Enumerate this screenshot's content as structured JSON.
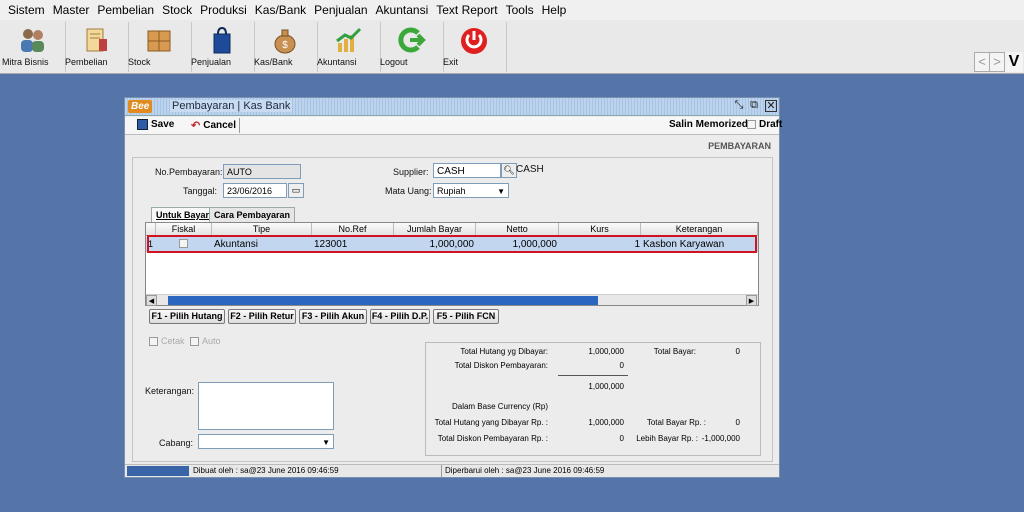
{
  "menu": [
    "Sistem",
    "Master",
    "Pembelian",
    "Stock",
    "Produksi",
    "Kas/Bank",
    "Penjualan",
    "Akuntansi",
    "Text Report",
    "Tools",
    "Help"
  ],
  "toolbar": [
    {
      "label": "Mitra Bisnis",
      "icon": "people-icon"
    },
    {
      "label": "Pembelian",
      "icon": "purchase-icon"
    },
    {
      "label": "Stock",
      "icon": "box-icon"
    },
    {
      "label": "Penjualan",
      "icon": "shopping-bag-icon"
    },
    {
      "label": "Kas/Bank",
      "icon": "money-bag-icon"
    },
    {
      "label": "Akuntansi",
      "icon": "chart-icon"
    },
    {
      "label": "Logout",
      "icon": "logout-icon"
    },
    {
      "label": "Exit",
      "icon": "power-icon"
    }
  ],
  "nav": {
    "prev": "<",
    "next": ">",
    "v": "V"
  },
  "window": {
    "logo": "Bee",
    "title": "Pembayaran | Kas Bank",
    "save": "Save",
    "cancel": "Cancel",
    "salin": "Salin Memorized",
    "draft": "Draft",
    "header": "PEMBAYARAN"
  },
  "form": {
    "no_label": "No.Pembayaran:",
    "no_value": "AUTO",
    "tanggal_label": "Tanggal:",
    "tanggal_value": "23/06/2016",
    "supplier_label": "Supplier:",
    "supplier_value": "CASH",
    "supplier_name": "CASH",
    "mata_uang_label": "Mata Uang:",
    "mata_uang_value": "Rupiah"
  },
  "tabs": [
    "Untuk Bayar",
    "Cara Pembayaran"
  ],
  "grid": {
    "columns": [
      "Fiskal",
      "Tipe",
      "No.Ref",
      "Jumlah Bayar",
      "Netto",
      "Kurs",
      "Keterangan"
    ],
    "rows": [
      {
        "no": "1",
        "tipe": "Akuntansi",
        "no_ref": "123001",
        "jumlah_bayar": "1,000,000",
        "netto": "1,000,000",
        "kurs": "1",
        "keterangan": "Kasbon Karyawan"
      }
    ]
  },
  "fbuttons": [
    "F1 - Pilih Hutang",
    "F2 - Pilih Retur",
    "F3 - Pilih Akun",
    "F4 - Pilih D.P.",
    "F5 - Pilih FCN"
  ],
  "checks": {
    "cetak": "Cetak",
    "auto": "Auto"
  },
  "bottom": {
    "keterangan_label": "Keterangan:",
    "cabang_label": "Cabang:"
  },
  "summary": {
    "total_hutang_label": "Total Hutang yg Dibayar:",
    "total_hutang_value": "1,000,000",
    "total_bayar_label": "Total Bayar:",
    "total_bayar_value": "0",
    "total_diskon_label": "Total Diskon Pembayaran:",
    "total_diskon_value": "0",
    "subtotal_value": "1,000,000",
    "base_currency_label": "Dalam Base Currency (Rp)",
    "total_hutang_rp_label": "Total Hutang yang Dibayar Rp. :",
    "total_hutang_rp_value": "1,000,000",
    "total_bayar_rp_label": "Total Bayar Rp. :",
    "total_bayar_rp_value": "0",
    "total_diskon_rp_label": "Total Diskon Pembayaran Rp. :",
    "total_diskon_rp_value": "0",
    "lebih_bayar_label": "Lebih Bayar Rp. :",
    "lebih_bayar_value": "-1,000,000"
  },
  "status": {
    "dibuat": "Dibuat oleh : sa@23 June 2016  09:46:59",
    "diperbarui": "Diperbarui oleh : sa@23 June 2016  09:46:59"
  }
}
